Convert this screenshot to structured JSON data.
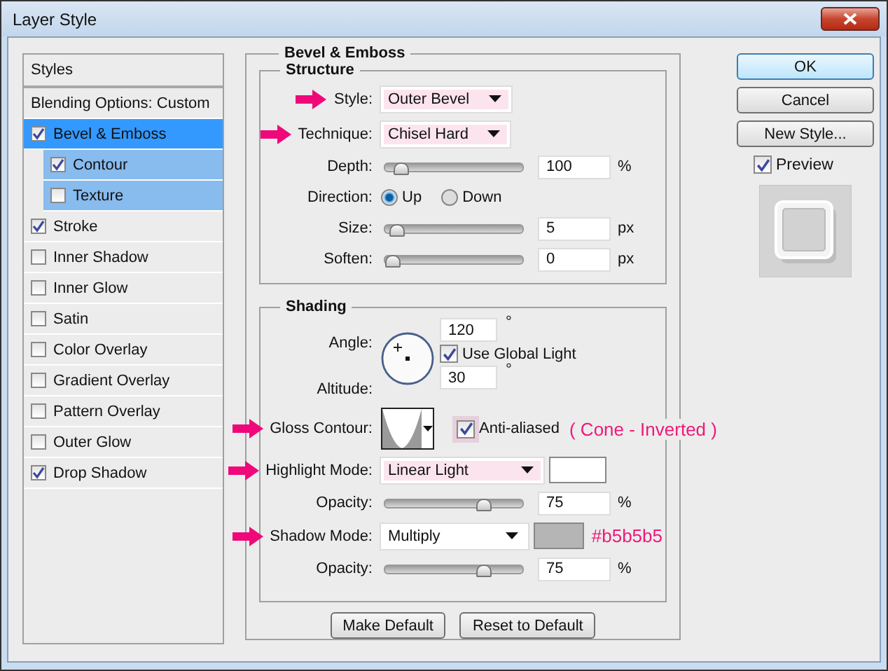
{
  "window": {
    "title": "Layer Style"
  },
  "styles_panel": {
    "header": "Styles",
    "items": [
      {
        "kind": "option",
        "label": "Blending Options: Custom",
        "selected": false
      },
      {
        "kind": "effect",
        "label": "Bevel & Emboss",
        "checked": true,
        "selected": true,
        "children": [
          {
            "kind": "effect",
            "label": "Contour",
            "checked": true,
            "selected": false
          },
          {
            "kind": "effect",
            "label": "Texture",
            "checked": false,
            "selected": false
          }
        ]
      },
      {
        "kind": "effect",
        "label": "Stroke",
        "checked": true,
        "selected": false
      },
      {
        "kind": "effect",
        "label": "Inner Shadow",
        "checked": false,
        "selected": false
      },
      {
        "kind": "effect",
        "label": "Inner Glow",
        "checked": false,
        "selected": false
      },
      {
        "kind": "effect",
        "label": "Satin",
        "checked": false,
        "selected": false
      },
      {
        "kind": "effect",
        "label": "Color Overlay",
        "checked": false,
        "selected": false
      },
      {
        "kind": "effect",
        "label": "Gradient Overlay",
        "checked": false,
        "selected": false
      },
      {
        "kind": "effect",
        "label": "Pattern Overlay",
        "checked": false,
        "selected": false
      },
      {
        "kind": "effect",
        "label": "Outer Glow",
        "checked": false,
        "selected": false
      },
      {
        "kind": "effect",
        "label": "Drop Shadow",
        "checked": true,
        "selected": false
      }
    ]
  },
  "bevel_emboss": {
    "title": "Bevel & Emboss",
    "structure": {
      "title": "Structure",
      "rows": [
        {
          "kind": "dropdown",
          "label": "Style:",
          "value": "Outer Bevel",
          "arrow": true,
          "highlighted": true
        },
        {
          "kind": "dropdown",
          "label": "Technique:",
          "value": "Chisel Hard",
          "arrow": true,
          "highlighted": true
        },
        {
          "kind": "slider",
          "label": "Depth:",
          "level": 0.07,
          "value": "100",
          "unit": "%"
        },
        {
          "kind": "radio",
          "label": "Direction:",
          "options": [
            {
              "label": "Up",
              "selected": true
            },
            {
              "label": "Down",
              "selected": false
            }
          ]
        },
        {
          "kind": "slider",
          "label": "Size:",
          "level": 0.03,
          "value": "5",
          "unit": "px"
        },
        {
          "kind": "slider",
          "label": "Soften:",
          "level": 0,
          "value": "0",
          "unit": "px"
        }
      ]
    },
    "shading": {
      "title": "Shading",
      "angle": {
        "label": "Angle:",
        "value": "120",
        "unit": "°"
      },
      "global_light": {
        "label": "Use Global Light",
        "checked": true
      },
      "altitude": {
        "label": "Altitude:",
        "value": "30",
        "unit": "°"
      },
      "rows": [
        {
          "kind": "contour",
          "label": "Gloss Contour:",
          "arrow": true,
          "checkbox": {
            "label": "Anti-aliased",
            "checked": true,
            "highlighted": true
          },
          "note": "( Cone - Inverted )"
        },
        {
          "kind": "mode",
          "label": "Highlight Mode:",
          "value": "Linear Light",
          "arrow": true,
          "highlighted": true,
          "color": "#ffffff"
        },
        {
          "kind": "slider",
          "label": "Opacity:",
          "level": 0.75,
          "value": "75",
          "unit": "%"
        },
        {
          "kind": "mode",
          "label": "Shadow Mode:",
          "value": "Multiply",
          "arrow": true,
          "highlighted": false,
          "color": "#b5b5b5",
          "note": "#b5b5b5"
        },
        {
          "kind": "slider",
          "label": "Opacity:",
          "level": 0.75,
          "value": "75",
          "unit": "%"
        }
      ]
    },
    "buttons": [
      "Make Default",
      "Reset to Default"
    ]
  },
  "side": {
    "buttons": [
      {
        "label": "OK",
        "default": true
      },
      {
        "label": "Cancel",
        "default": false
      },
      {
        "label": "New Style...",
        "default": false
      }
    ],
    "preview": {
      "label": "Preview",
      "checked": true
    }
  }
}
